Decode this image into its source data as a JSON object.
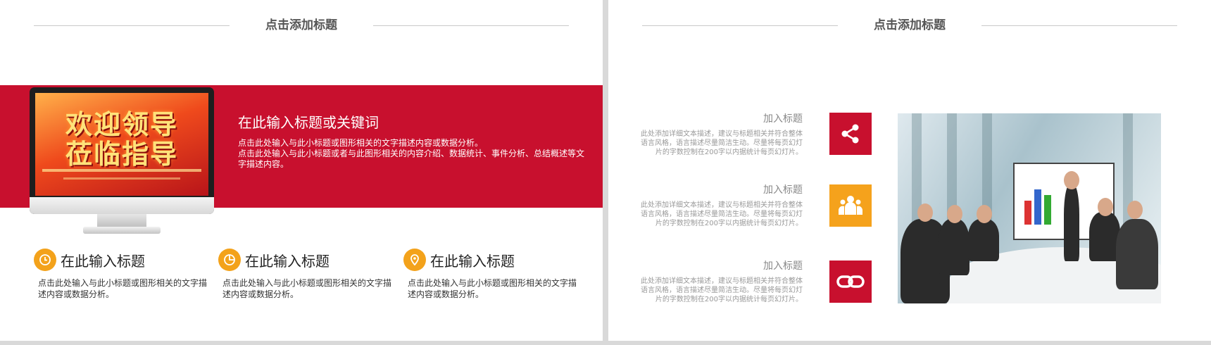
{
  "left_slide": {
    "title": "点击添加标题",
    "monitor_screen": {
      "line1": "欢迎领导",
      "line2": "莅临指导"
    },
    "band_title": "在此输入标题或关键词",
    "band_text": [
      "点击此处输入与此小标题或图形相关的文字描述内容或数据分析。",
      "点击此处输入与此小标题或者与此图形相关的内容介绍、数据统计、事件分析、总结概述等文字描述内容。"
    ],
    "features": [
      {
        "icon": "clock-icon",
        "title": "在此输入标题",
        "text": "点击此处输入与此小标题或图形相关的文字描述内容或数据分析。"
      },
      {
        "icon": "pie-chart-icon",
        "title": "在此输入标题",
        "text": "点击此处输入与此小标题或图形相关的文字描述内容或数据分析。"
      },
      {
        "icon": "location-pin-icon",
        "title": "在此输入标题",
        "text": "点击此处输入与此小标题或图形相关的文字描述内容或数据分析。"
      }
    ]
  },
  "right_slide": {
    "title": "点击添加标题",
    "items": [
      {
        "title": "加入标题",
        "text": "此处添加详细文本描述，建议与标题相关并符合整体语言风格，语言描述尽量简洁生动。尽量将每页幻灯片的字数控制在200字以内据统计每页幻灯片。",
        "icon": "share-icon",
        "color": "#c8102e"
      },
      {
        "title": "加入标题",
        "text": "此处添加详细文本描述，建议与标题相关并符合整体语言风格，语言描述尽量简洁生动。尽量将每页幻灯片的字数控制在200字以内据统计每页幻灯片。",
        "icon": "team-icon",
        "color": "#f5a21c"
      },
      {
        "title": "加入标题",
        "text": "此处添加详细文本描述，建议与标题相关并符合整体语言风格，语言描述尽量简洁生动。尽量将每页幻灯片的字数控制在200字以内据统计每页幻灯片。",
        "icon": "link-icon",
        "color": "#c8102e"
      }
    ]
  },
  "colors": {
    "accent_red": "#c8102e",
    "accent_orange": "#f3a21b"
  }
}
